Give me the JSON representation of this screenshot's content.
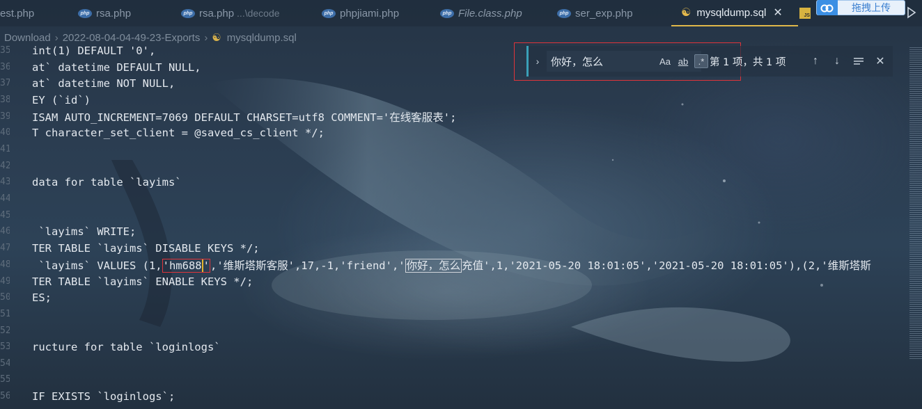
{
  "tabs": [
    {
      "label": "est.php",
      "icon": "php-icon",
      "active": false
    },
    {
      "label": "rsa.php",
      "icon": "php-icon",
      "active": false
    },
    {
      "label": "rsa.php",
      "sub": "...\\decode",
      "icon": "php-icon",
      "active": false
    },
    {
      "label": "phpjiami.php",
      "icon": "php-icon",
      "active": false
    },
    {
      "label": "File.class.php",
      "icon": "php-icon",
      "active": false,
      "italic": true
    },
    {
      "label": "ser_exp.php",
      "icon": "php-icon",
      "active": false
    },
    {
      "label": "mysqldump.sql",
      "icon": "database-icon",
      "active": true
    },
    {
      "label": "JS",
      "icon": "js-icon",
      "active": false
    }
  ],
  "upload_widget": {
    "label": "拖拽上传"
  },
  "breadcrumb": {
    "items": [
      "Download",
      "2022-08-04-04-49-23-Exports",
      "mysqldump.sql"
    ]
  },
  "find": {
    "value": "你好，怎么",
    "match_case_label": "Aa",
    "whole_word_label": "ab",
    "regex_label": ".*",
    "match_count": "第 1 项，共 1 项"
  },
  "code_lines": [
    {
      "ln": "35",
      "text": "int(1) DEFAULT '0',"
    },
    {
      "ln": "36",
      "text": "at` datetime DEFAULT NULL,"
    },
    {
      "ln": "37",
      "text": "at` datetime NOT NULL,"
    },
    {
      "ln": "38",
      "text": "EY (`id`)"
    },
    {
      "ln": "39",
      "text": "ISAM AUTO_INCREMENT=7069 DEFAULT CHARSET=utf8 COMMENT='在线客服表';"
    },
    {
      "ln": "40",
      "text": "T character_set_client = @saved_cs_client */;"
    },
    {
      "ln": "41",
      "text": ""
    },
    {
      "ln": "42",
      "text": ""
    },
    {
      "ln": "43",
      "text": "data for table `layims`"
    },
    {
      "ln": "44",
      "text": ""
    },
    {
      "ln": "45",
      "text": ""
    },
    {
      "ln": "46",
      "text": " `layims` WRITE;"
    },
    {
      "ln": "47",
      "text": "TER TABLE `layims` DISABLE KEYS */;"
    },
    {
      "ln": "48",
      "text_parts": [
        " `layims` VALUES (1,",
        "'hm688",
        "'",
        ",'维斯塔斯客服',17,-1,'friend','",
        "你好，怎么",
        "充值',1,'2021-05-20 18:01:05','2021-05-20 18:01:05'),(2,'维斯塔斯"
      ]
    },
    {
      "ln": "49",
      "text": "TER TABLE `layims` ENABLE KEYS */;"
    },
    {
      "ln": "50",
      "text": "ES;"
    },
    {
      "ln": "51",
      "text": ""
    },
    {
      "ln": "52",
      "text": ""
    },
    {
      "ln": "53",
      "text": "ructure for table `loginlogs`"
    },
    {
      "ln": "54",
      "text": ""
    },
    {
      "ln": "55",
      "text": ""
    },
    {
      "ln": "56",
      "text": "IF EXISTS `loginlogs`;"
    }
  ],
  "colors": {
    "accent_caret": "#e4b52c",
    "find_border": "#3aa0b8",
    "annotation_red": "#e0343a"
  }
}
